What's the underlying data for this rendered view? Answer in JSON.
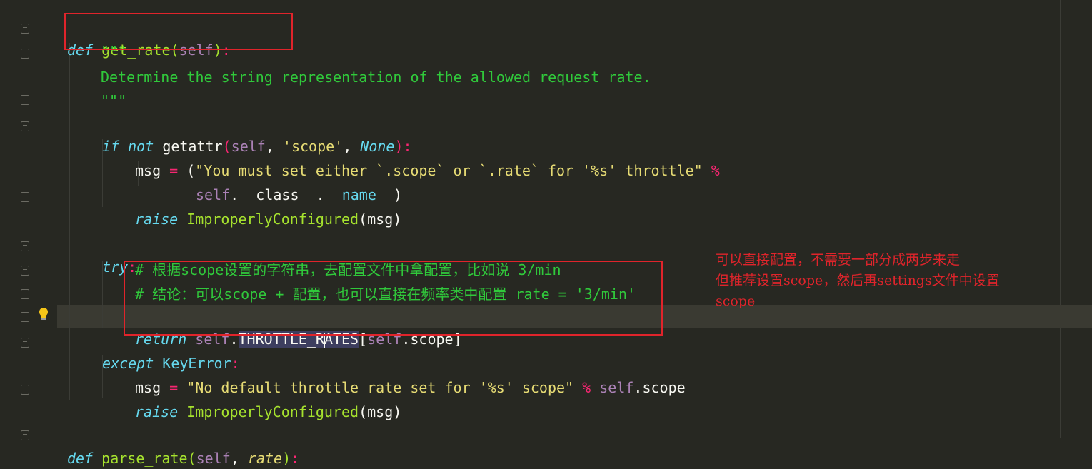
{
  "code": {
    "l1": {
      "def": "def",
      "name": "get_rate",
      "open": "(",
      "self": "self",
      "close": ")",
      "colon": ":"
    },
    "l2": "\"\"\"",
    "l3": "Determine the string representation of the allowed request rate.",
    "l4": "\"\"\"",
    "l5": {
      "if": "if",
      "not": "not",
      "fn": "getattr",
      "open": "(",
      "self": "self",
      "sep1": ", ",
      "str": "'scope'",
      "sep2": ", ",
      "none": "None",
      "close": ")",
      "colon": ":"
    },
    "l6": {
      "var": "msg",
      "eq": " = ",
      "open": "(",
      "str": "\"You must set either `.scope` or `.rate` for '%s' throttle\"",
      "op": " %"
    },
    "l7": {
      "self": "self",
      "dot1": ".",
      "attr1": "__class__",
      "dot2": ".",
      "attr2": "__name__",
      "close": ")"
    },
    "l8": {
      "raise": "raise",
      "cls": "ImproperlyConfigured",
      "args": "(msg)"
    },
    "l10": {
      "try": "try",
      "colon": ":"
    },
    "l11": "# 根据scope设置的字符串，去配置文件中拿配置，比如说 3/min",
    "l12": "# 结论：可以scope + 配置，也可以直接在频率类中配置 rate = '3/min'",
    "l13": {
      "return": "return",
      "self": "self",
      "dot": ".",
      "attr_a": "THROTTLE_R",
      "attr_b": "ATES",
      "open": "[",
      "self2": "self",
      "rest": ".scope]"
    },
    "l14": {
      "except": "except",
      "err": "KeyError",
      "colon": ":"
    },
    "l15": {
      "var": "msg",
      "eq": " = ",
      "str": "\"No default throttle rate set for '%s' scope\"",
      "op": " %",
      "self": " self",
      "rest": ".scope"
    },
    "l16": {
      "raise": "raise",
      "cls": "ImproperlyConfigured",
      "args": "(msg)"
    },
    "l18": {
      "def": "def",
      "name": "parse_rate",
      "open": "(",
      "self": "self",
      "sep": ", ",
      "arg": "rate",
      "close": ")",
      "colon": ":"
    }
  },
  "note": {
    "line1": "可以直接配置，不需要一部分成两步来走",
    "line2": "但推荐设置scope，然后再settings文件中设置",
    "line3": "scope"
  },
  "colors": {
    "annotation": "#e0242b",
    "background": "#272822"
  }
}
